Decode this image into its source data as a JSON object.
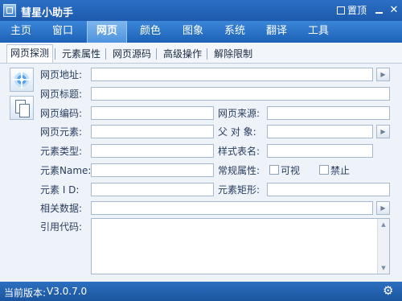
{
  "window": {
    "title": "彗星小助手",
    "pin_label": "置顶",
    "minimize_glyph": "",
    "close_glyph": "✕"
  },
  "menu": [
    {
      "label": "主页",
      "active": false
    },
    {
      "label": "窗口",
      "active": false
    },
    {
      "label": "网页",
      "active": true
    },
    {
      "label": "颜色",
      "active": false
    },
    {
      "label": "图象",
      "active": false
    },
    {
      "label": "系统",
      "active": false
    },
    {
      "label": "翻译",
      "active": false
    },
    {
      "label": "工具",
      "active": false
    }
  ],
  "tabs": [
    {
      "label": "网页探测",
      "active": true
    },
    {
      "label": "元素属性",
      "active": false
    },
    {
      "label": "网页源码",
      "active": false
    },
    {
      "label": "高级操作",
      "active": false
    },
    {
      "label": "解除限制",
      "active": false
    }
  ],
  "fields": {
    "url_label": "网页地址:",
    "url_value": "",
    "title_label": "网页标题:",
    "title_value": "",
    "encoding_label": "网页编码:",
    "encoding_value": "",
    "source_label": "网页来源:",
    "source_value": "",
    "element_label": "网页元素:",
    "element_value": "",
    "parent_label": "父 对 象:",
    "parent_value": "",
    "type_label": "元素类型:",
    "type_value": "",
    "style_label": "样式表名:",
    "style_value": "",
    "name_label": "元素Name:",
    "name_value": "",
    "common_label": "常规属性:",
    "visible_label": "可视",
    "disabled_label": "禁止",
    "id_label": "元素 I D:",
    "id_value": "",
    "rect_label": "元素矩形:",
    "rect_value": "",
    "related_label": "相关数据:",
    "related_value": "",
    "code_label": "引用代码:"
  },
  "status": {
    "version_label": "当前版本:",
    "version_value": "V3.0.7.0"
  },
  "icons": {
    "arrow": "▶",
    "scroll_up": "▲",
    "scroll_down": "▼",
    "gear": "⚙"
  }
}
